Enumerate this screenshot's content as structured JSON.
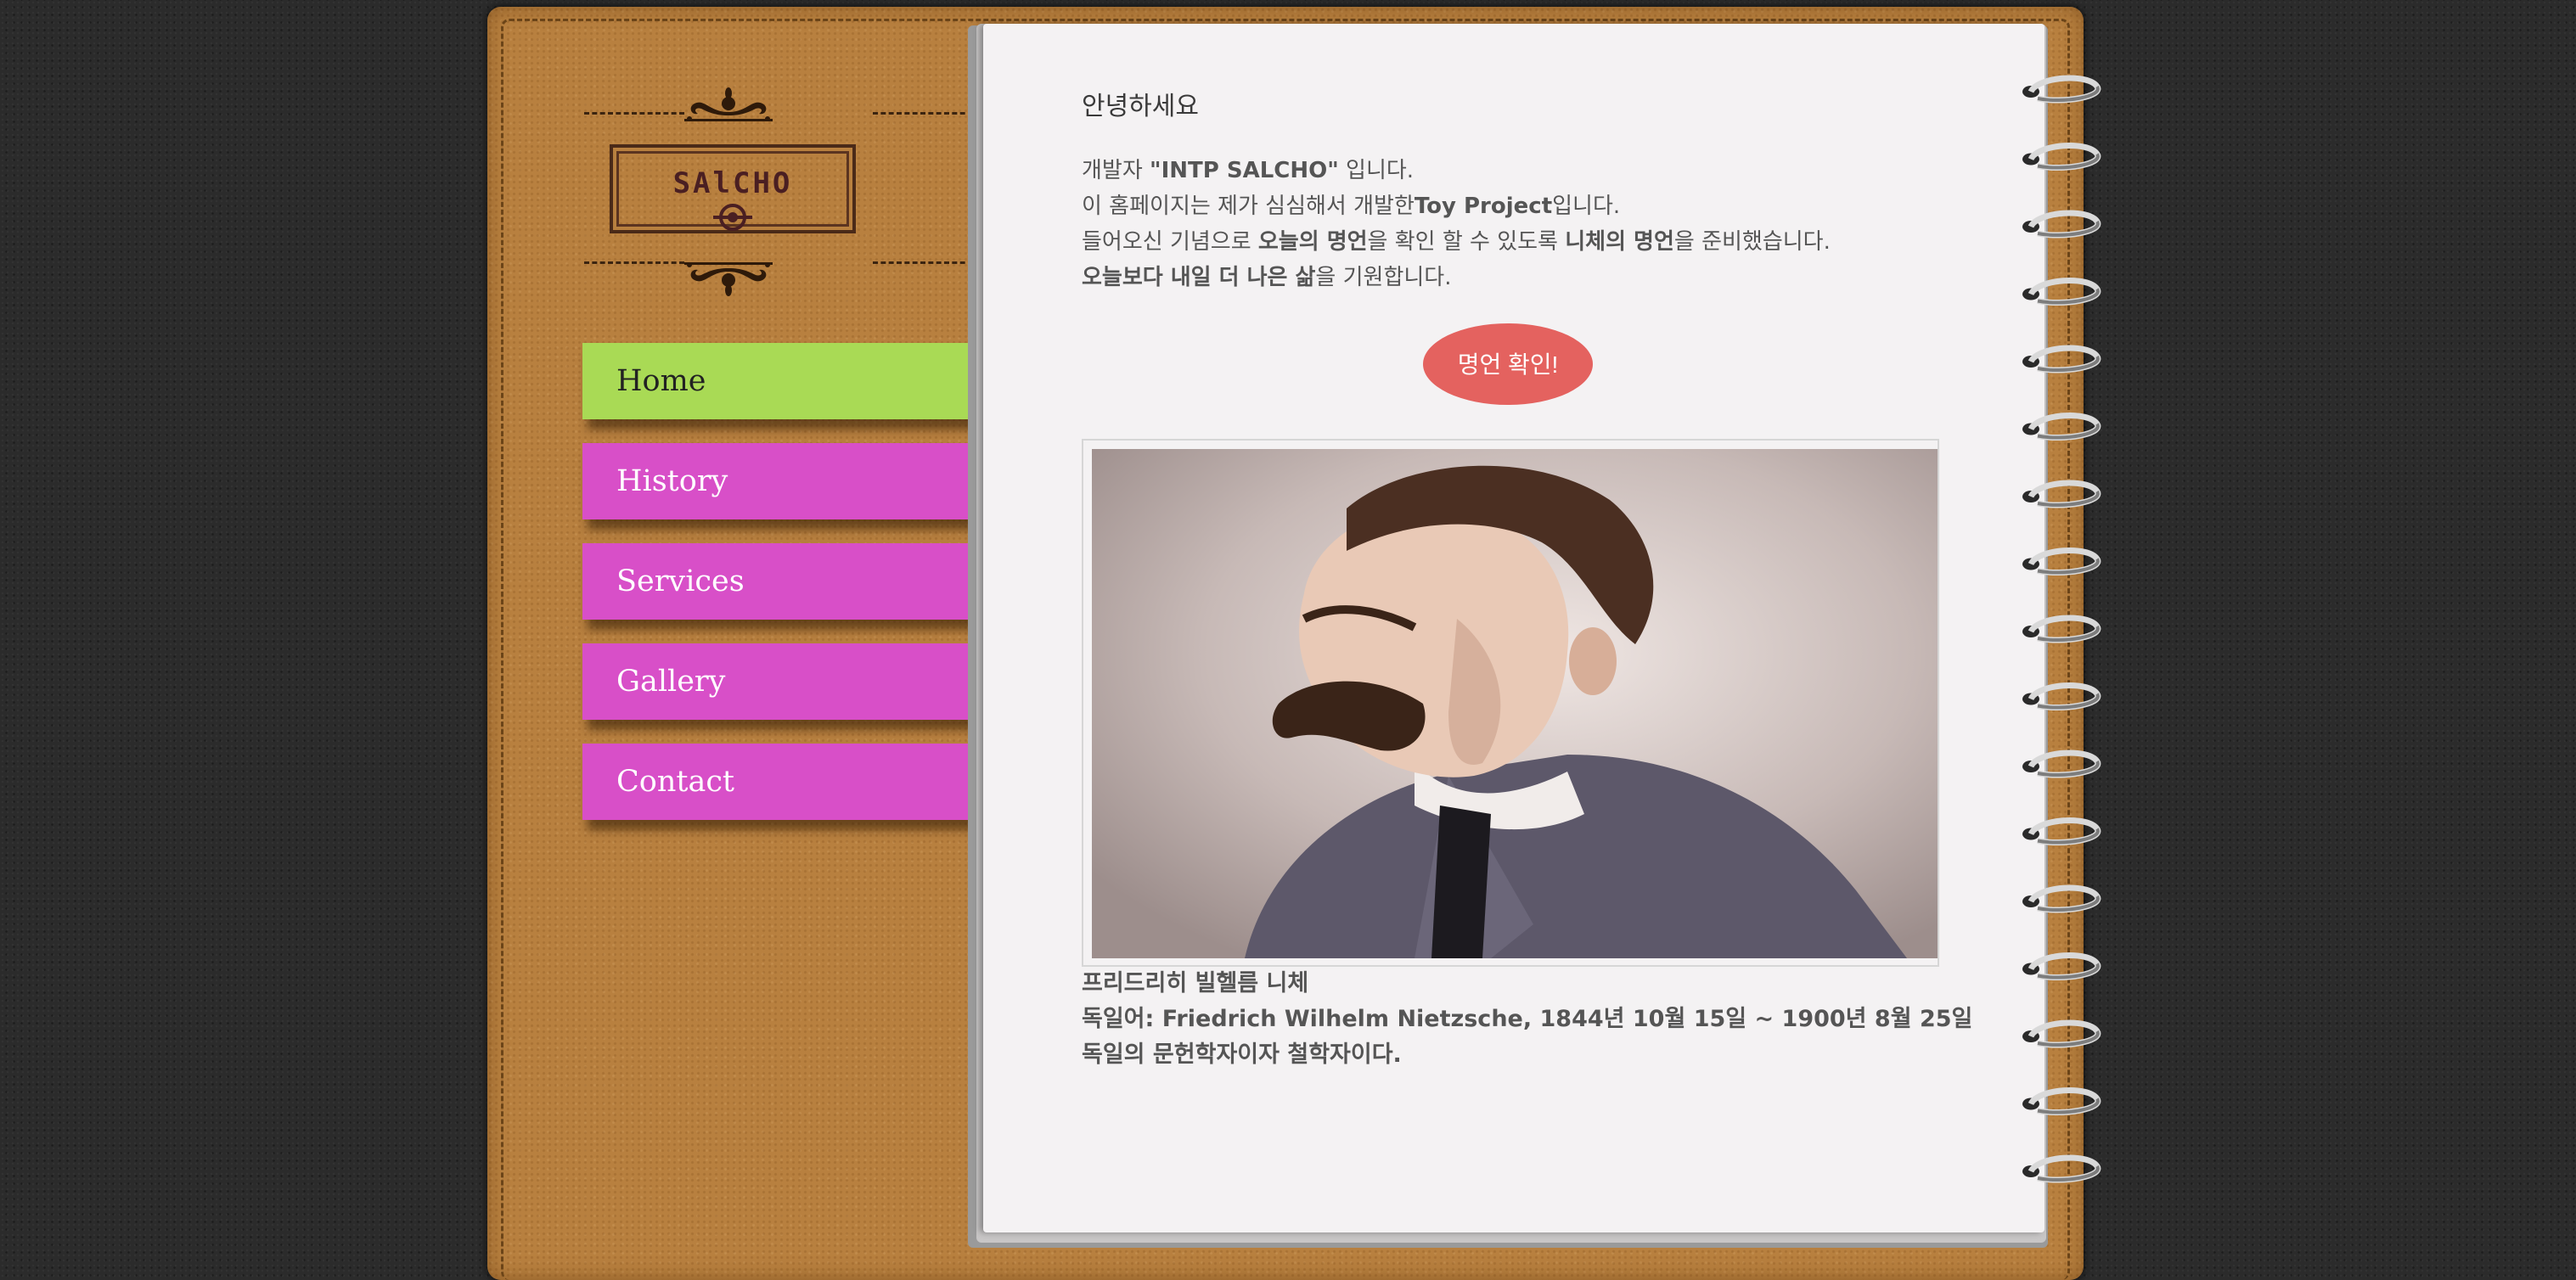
{
  "logo": {
    "text": "SAlCHO"
  },
  "nav": {
    "items": [
      {
        "label": "Home",
        "active": true
      },
      {
        "label": "History"
      },
      {
        "label": "Services"
      },
      {
        "label": "Gallery"
      },
      {
        "label": "Contact"
      }
    ]
  },
  "main": {
    "greeting": "안녕하세요",
    "intro": {
      "line1_pre": "개발자 ",
      "line1_bold": "\"INTP SALCHO\"",
      "line1_post": " 입니다.",
      "line2_pre": "이 홈페이지는 제가 심심해서 개발한",
      "line2_bold": "Toy Project",
      "line2_post": "입니다.",
      "line3_pre": "들어오신 기념으로 ",
      "line3_bold1": "오늘의 명언",
      "line3_mid": "을 확인 할 수 있도록 ",
      "line3_bold2": "니체의 명언",
      "line3_post": "을 준비했습니다.",
      "line4_bold": "오늘보다 내일 더 나은 삶",
      "line4_post": "을 기원합니다."
    },
    "quote_button": "명언 확인!",
    "caption": {
      "name": "프리드리히 빌헬름 니체",
      "german": "독일어: Friedrich Wilhelm Nietzsche, 1844년 10월 15일 ~ 1900년 8월 25일",
      "desc": "독일의 문헌학자이자 철학자이다."
    }
  },
  "colors": {
    "nav_active": "#a9da55",
    "nav_default": "#d84fc8",
    "button": "#e4625f",
    "cover": "#b8803f"
  }
}
